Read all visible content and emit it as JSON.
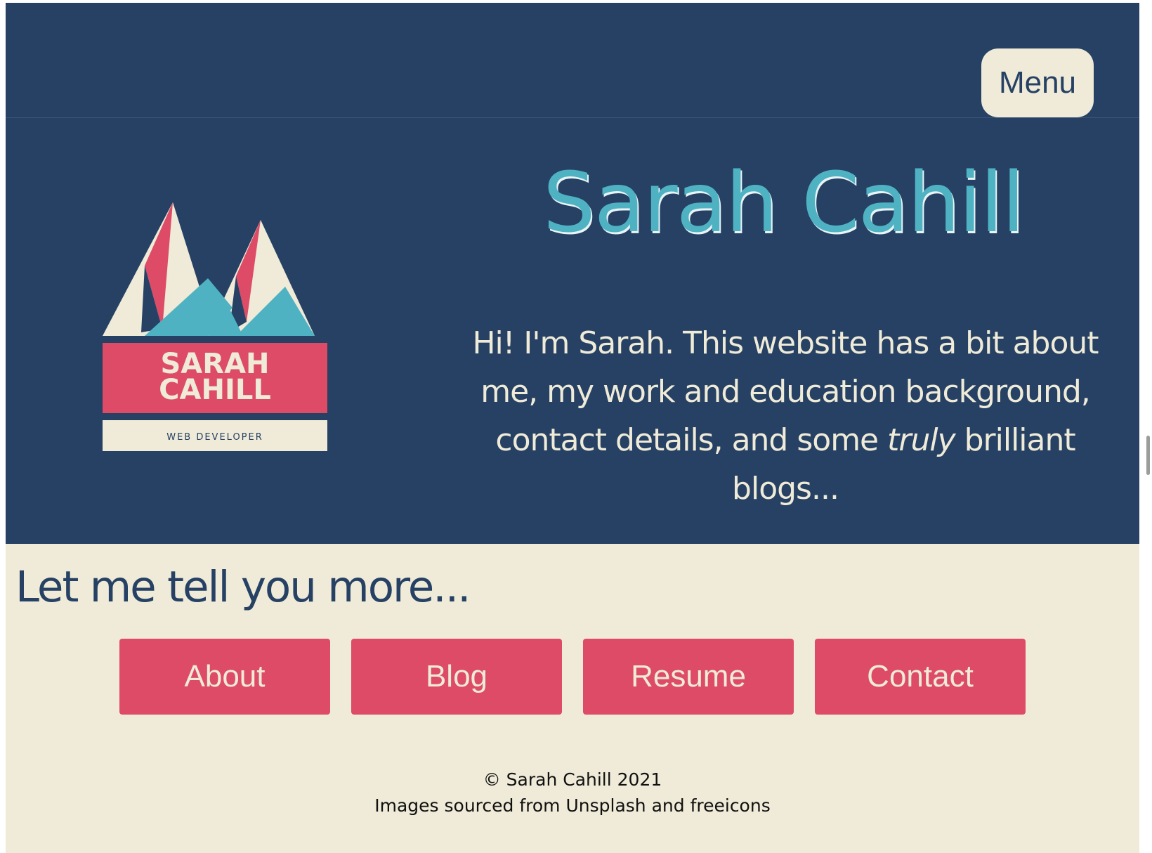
{
  "header": {
    "menu_label": "Menu"
  },
  "hero": {
    "logo": {
      "name_line1": "SARAH",
      "name_line2": "CAHILL",
      "tagline": "WEB DEVELOPER"
    },
    "title": "Sarah Cahill",
    "intro_before": "Hi! I'm Sarah. This website has a bit about me, my work and education background, contact details, and some ",
    "intro_emphasis": "truly",
    "intro_after": " brilliant blogs..."
  },
  "more": {
    "heading": "Let me tell you more...",
    "buttons": [
      {
        "label": "About"
      },
      {
        "label": "Blog"
      },
      {
        "label": "Resume"
      },
      {
        "label": "Contact"
      }
    ]
  },
  "footer": {
    "copyright": "© Sarah Cahill 2021",
    "credits": "Images sourced from Unsplash and freeicons"
  },
  "colors": {
    "navy": "#264164",
    "cream": "#efebd8",
    "teal": "#4fb2c2",
    "pink": "#dd4b67"
  }
}
